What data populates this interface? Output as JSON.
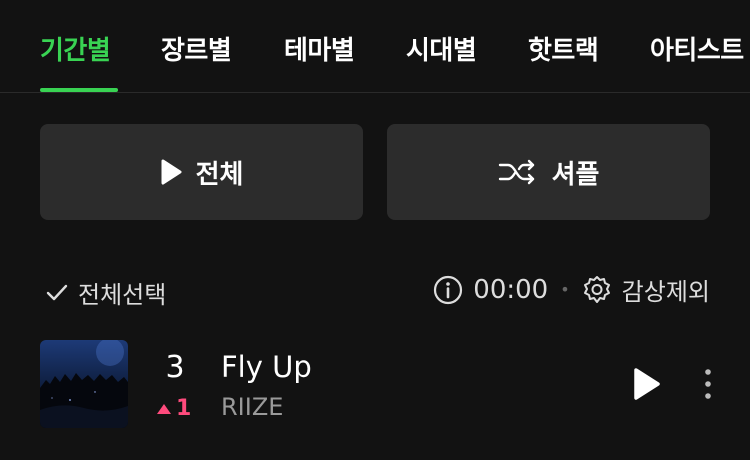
{
  "tabs": [
    {
      "label": "기간별",
      "active": true
    },
    {
      "label": "장르별"
    },
    {
      "label": "테마별"
    },
    {
      "label": "시대별"
    },
    {
      "label": "핫트랙"
    },
    {
      "label": "아티스트"
    }
  ],
  "actions": {
    "play_all_label": "전체",
    "shuffle_label": "셔플"
  },
  "list_controls": {
    "select_all_label": "전체선택",
    "duration": "00:00",
    "exclude_label": "감상제외"
  },
  "tracks": [
    {
      "rank": "3",
      "change": "1",
      "change_direction": "up",
      "title": "Fly Up",
      "artist": "RIIZE"
    }
  ],
  "colors": {
    "accent": "#39d353",
    "rank_up": "#ff4b7d",
    "background": "#121212",
    "button_bg": "#2c2c2c"
  }
}
